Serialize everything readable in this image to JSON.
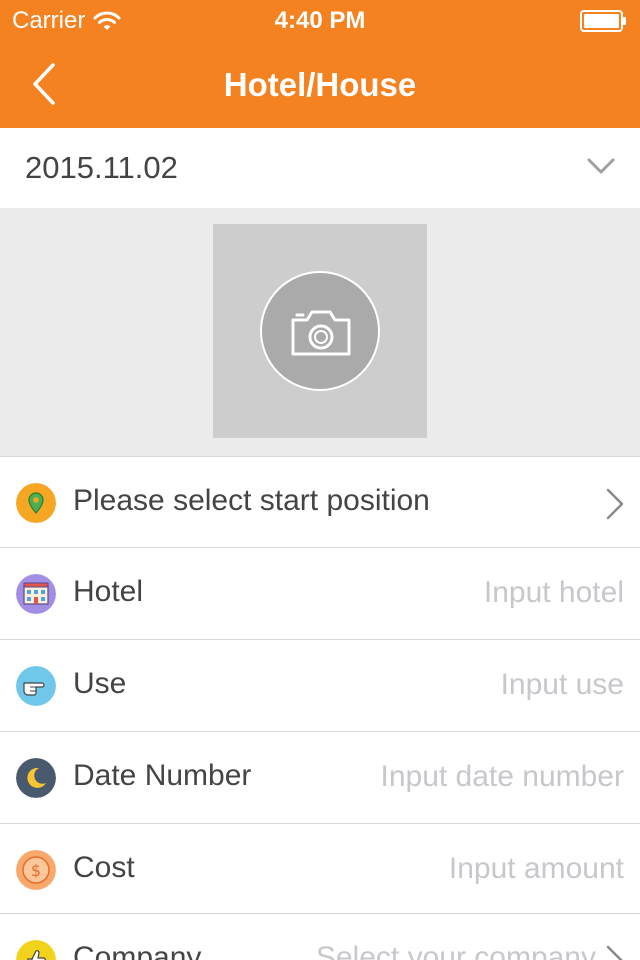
{
  "status_bar": {
    "carrier": "Carrier",
    "time": "4:40 PM"
  },
  "nav": {
    "title": "Hotel/House"
  },
  "date_row": {
    "value": "2015.11.02"
  },
  "rows": {
    "start_position": {
      "label": "Please select start position",
      "icon": "location-pin-icon"
    },
    "hotel": {
      "label": "Hotel",
      "placeholder": "Input hotel",
      "icon": "hotel-building-icon"
    },
    "use": {
      "label": "Use",
      "placeholder": "Input use",
      "icon": "pointing-hand-icon"
    },
    "date_number": {
      "label": "Date Number",
      "placeholder": "Input date number",
      "icon": "moon-icon"
    },
    "cost": {
      "label": "Cost",
      "placeholder": "Input amount",
      "icon": "dollar-coin-icon"
    },
    "company": {
      "label": "Company",
      "placeholder": "Select your company",
      "icon": "thumbs-up-icon"
    }
  },
  "colors": {
    "brand": "#f58220",
    "background_gray": "#ececec",
    "placeholder": "#c7c7cc"
  }
}
